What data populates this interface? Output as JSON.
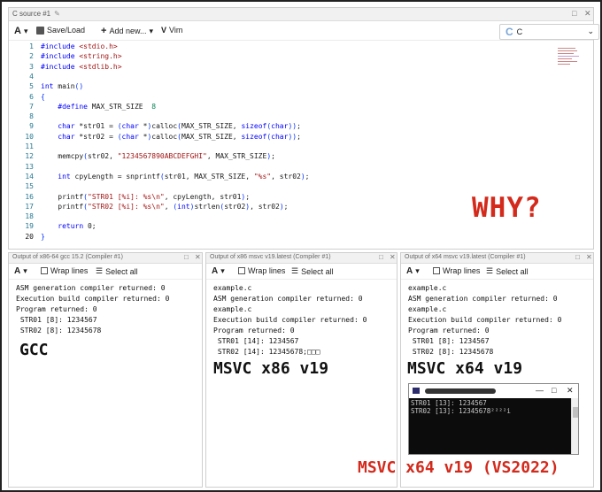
{
  "editor": {
    "tab_title": "C source #1",
    "toolbar": {
      "font_btn": "A",
      "save_load": "Save/Load",
      "add_new": "Add new...",
      "vim": "Vim"
    },
    "language": "C",
    "lines": [
      {
        "n": "1",
        "t": "#include <stdio.h>"
      },
      {
        "n": "2",
        "t": "#include <string.h>"
      },
      {
        "n": "3",
        "t": "#include <stdlib.h>"
      },
      {
        "n": "4",
        "t": ""
      },
      {
        "n": "5",
        "t": "int main()"
      },
      {
        "n": "6",
        "t": "{"
      },
      {
        "n": "7",
        "t": "    #define MAX_STR_SIZE  8"
      },
      {
        "n": "8",
        "t": ""
      },
      {
        "n": "9",
        "t": "    char *str01 = (char *)calloc(MAX_STR_SIZE, sizeof(char));"
      },
      {
        "n": "10",
        "t": "    char *str02 = (char *)calloc(MAX_STR_SIZE, sizeof(char));"
      },
      {
        "n": "11",
        "t": ""
      },
      {
        "n": "12",
        "t": "    memcpy(str02, \"1234567890ABCDEFGHI\", MAX_STR_SIZE);"
      },
      {
        "n": "13",
        "t": ""
      },
      {
        "n": "14",
        "t": "    int cpyLength = snprintf(str01, MAX_STR_SIZE, \"%s\", str02);"
      },
      {
        "n": "15",
        "t": ""
      },
      {
        "n": "16",
        "t": "    printf(\"STR01 [%i]: %s\\n\", cpyLength, str01);"
      },
      {
        "n": "17",
        "t": "    printf(\"STR02 [%i]: %s\\n\", (int)strlen(str02), str02);"
      },
      {
        "n": "18",
        "t": ""
      },
      {
        "n": "19",
        "t": "    return 0;"
      },
      {
        "n": "20",
        "t": "}"
      }
    ],
    "annotation": "WHY?"
  },
  "panes": [
    {
      "title": "Output of x86-64 gcc 15.2 (Compiler #1)",
      "font_btn": "A",
      "wrap_lines": "Wrap lines",
      "select_all": "Select all",
      "output": [
        "ASM generation compiler returned: 0",
        "Execution build compiler returned: 0",
        "Program returned: 0",
        " STR01 [8]: 1234567",
        " STR02 [8]: 12345678"
      ],
      "label": "GCC"
    },
    {
      "title": "Output of x86 msvc v19.latest (Compiler #1)",
      "font_btn": "A",
      "wrap_lines": "Wrap lines",
      "select_all": "Select all",
      "output": [
        "example.c",
        "ASM generation compiler returned: 0",
        "example.c",
        "Execution build compiler returned: 0",
        "Program returned: 0",
        " STR01 [14]: 1234567",
        " STR02 [14]: 12345678;□□□"
      ],
      "label": "MSVC x86 v19"
    },
    {
      "title": "Output of x64 msvc v19.latest (Compiler #1)",
      "font_btn": "A",
      "wrap_lines": "Wrap lines",
      "select_all": "Select all",
      "output": [
        "example.c",
        "ASM generation compiler returned: 0",
        "example.c",
        "Execution build compiler returned: 0",
        "Program returned: 0",
        " STR01 [8]: 1234567",
        " STR02 [8]: 12345678"
      ],
      "label": "MSVC x64 v19"
    }
  ],
  "console": {
    "lines": [
      "STR01 [13]: 1234567",
      "STR02 [13]: 12345678²²²²i"
    ],
    "label": "MSVC x64 v19 (VS2022)"
  },
  "colors": {
    "annotation_red": "#d32a1c",
    "keyword": "#0000ff",
    "string": "#a31515",
    "line_number": "#237893"
  }
}
